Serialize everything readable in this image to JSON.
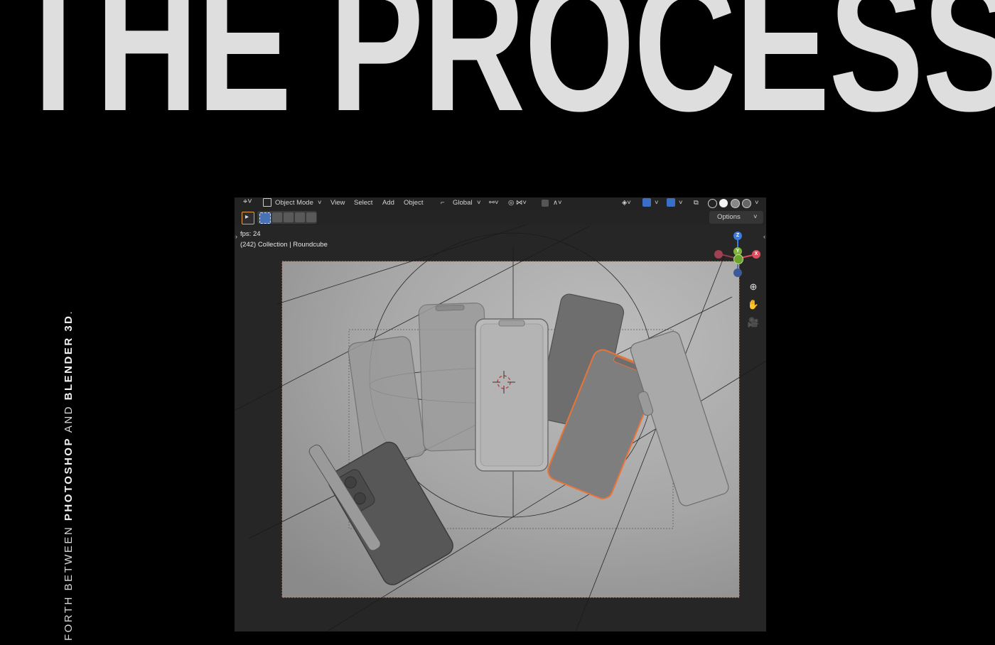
{
  "hero": {
    "title": "THE PROCESS"
  },
  "side_caption": {
    "lead": "FORTH BETWEEN ",
    "app1": "PHOTOSHOP",
    "and": " AND ",
    "app2": "BLENDER 3D",
    "end": "."
  },
  "blender": {
    "header": {
      "mode": "Object Mode",
      "menu": [
        "View",
        "Select",
        "Add",
        "Object"
      ],
      "orientation": "Global",
      "options": "Options"
    },
    "overlay": {
      "fps": "fps: 24",
      "collection": "(242) Collection | Roundcube"
    },
    "gizmo": {
      "z": "Z",
      "y": "Y",
      "x": "X"
    },
    "colors": {
      "axis_x": "#e04a5c",
      "axis_y": "#7eb43a",
      "axis_z": "#3a7de0",
      "selection": "#e8743a",
      "viewport_bg": "#2a2a2a"
    },
    "icons": [
      "zoom-icon",
      "hand-pan-icon",
      "camera-icon",
      "cursor-crosshair-icon"
    ]
  }
}
